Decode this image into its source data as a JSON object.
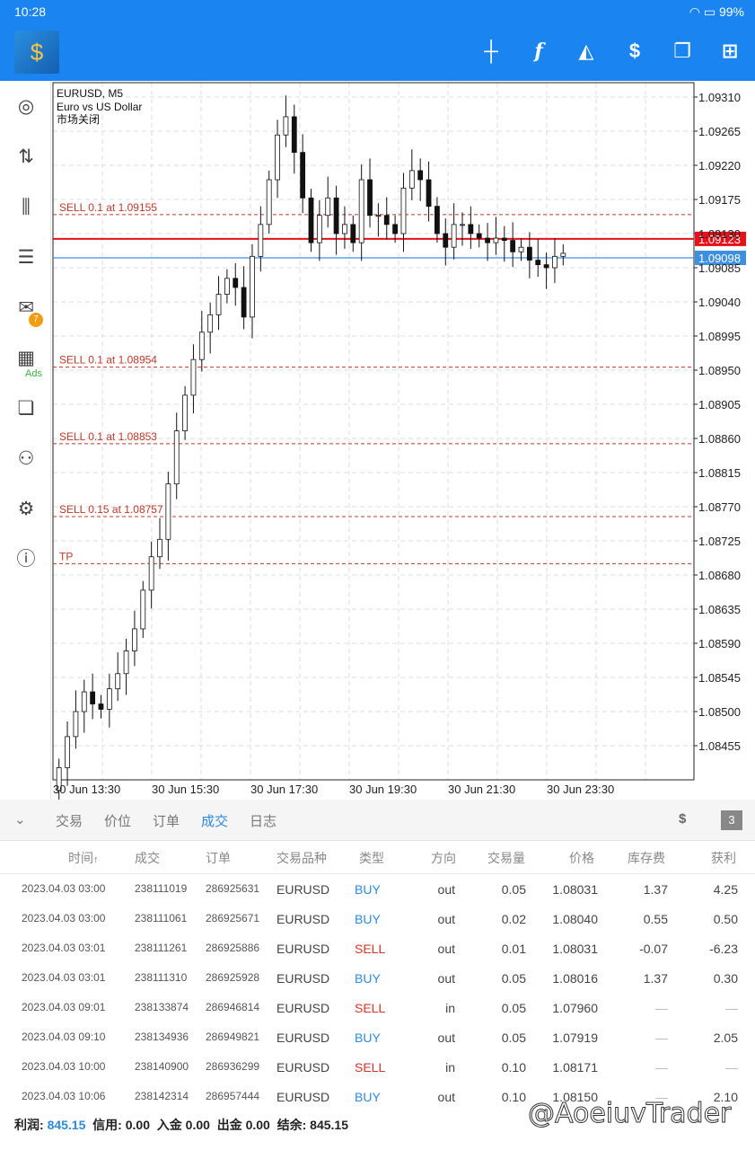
{
  "status_bar": {
    "time": "10:28",
    "battery": "99%"
  },
  "toolbar": {
    "icons": [
      "crosshair-icon",
      "function-icon",
      "objects-icon",
      "trade-icon",
      "windows-icon",
      "new-order-icon"
    ]
  },
  "sidebar": {
    "mail_badge": "7",
    "ads_label": "Ads"
  },
  "chart": {
    "symbol": "EURUSD, M5",
    "description": "Euro vs US Dollar",
    "status": "市场关闭",
    "price_ticks": [
      "1.09310",
      "1.09265",
      "1.09220",
      "1.09175",
      "1.09130",
      "1.09085",
      "1.09040",
      "1.08995",
      "1.08950",
      "1.08905",
      "1.08860",
      "1.08815",
      "1.08770",
      "1.08725",
      "1.08680",
      "1.08635",
      "1.08590",
      "1.08545",
      "1.08500",
      "1.08455"
    ],
    "time_ticks": [
      "30 Jun 13:30",
      "30 Jun 15:30",
      "30 Jun 17:30",
      "30 Jun 19:30",
      "30 Jun 21:30",
      "30 Jun 23:30"
    ],
    "bid": {
      "label": "1.09123",
      "price": 1.09123,
      "color": "#e8101a"
    },
    "ask": {
      "label": "1.09098",
      "price": 1.09098,
      "color": "#3d8fe0"
    },
    "order_lines": [
      {
        "label": "SELL 0.1 at 1.09155",
        "price": 1.09155
      },
      {
        "label": "SELL 0.1 at 1.08954",
        "price": 1.08954
      },
      {
        "label": "SELL 0.1 at 1.08853",
        "price": 1.08853
      },
      {
        "label": "SELL 0.15 at 1.08757",
        "price": 1.08757
      },
      {
        "label": "TP",
        "price": 1.08695
      }
    ],
    "closes": [
      1.08426,
      1.08467,
      1.085,
      1.08526,
      1.0851,
      1.08503,
      1.0853,
      1.0855,
      1.0858,
      1.08609,
      1.0866,
      1.08704,
      1.08727,
      1.088,
      1.0887,
      1.08917,
      1.08964,
      1.09,
      1.09023,
      1.0905,
      1.09071,
      1.09059,
      1.0902,
      1.091,
      1.09142,
      1.09201,
      1.0926,
      1.09284,
      1.09237,
      1.09177,
      1.09118,
      1.09154,
      1.09177,
      1.0913,
      1.09142,
      1.09118,
      1.09201,
      1.09154,
      1.09154,
      1.09142,
      1.0913,
      1.0919,
      1.09213,
      1.09201,
      1.09166,
      1.0913,
      1.09112,
      1.09142,
      1.09142,
      1.0913,
      1.09124,
      1.09118,
      1.09124,
      1.09121,
      1.09106,
      1.09112,
      1.09095,
      1.09089,
      1.09085,
      1.091,
      1.09104
    ]
  },
  "tabs": [
    {
      "label": "交易"
    },
    {
      "label": "价位"
    },
    {
      "label": "订单"
    },
    {
      "label": "成交",
      "active": true
    },
    {
      "label": "日志"
    }
  ],
  "tabs_badge": "3",
  "table": {
    "headers": [
      "时间",
      "成交",
      "订单",
      "交易品种",
      "类型",
      "方向",
      "交易量",
      "价格",
      "库存费",
      "获利"
    ],
    "sort_indicator": "↑",
    "rows": [
      [
        "2023.04.03 03:00",
        "238111019",
        "286925631",
        "EURUSD",
        "BUY",
        "out",
        "0.05",
        "1.08031",
        "1.37",
        "4.25"
      ],
      [
        "2023.04.03 03:00",
        "238111061",
        "286925671",
        "EURUSD",
        "BUY",
        "out",
        "0.02",
        "1.08040",
        "0.55",
        "0.50"
      ],
      [
        "2023.04.03 03:01",
        "238111261",
        "286925886",
        "EURUSD",
        "SELL",
        "out",
        "0.01",
        "1.08031",
        "-0.07",
        "-6.23"
      ],
      [
        "2023.04.03 03:01",
        "238111310",
        "286925928",
        "EURUSD",
        "BUY",
        "out",
        "0.05",
        "1.08016",
        "1.37",
        "0.30"
      ],
      [
        "2023.04.03 09:01",
        "238133874",
        "286946814",
        "EURUSD",
        "SELL",
        "in",
        "0.05",
        "1.07960",
        "—",
        "—"
      ],
      [
        "2023.04.03 09:10",
        "238134936",
        "286949821",
        "EURUSD",
        "BUY",
        "out",
        "0.05",
        "1.07919",
        "—",
        "2.05"
      ],
      [
        "2023.04.03 10:00",
        "238140900",
        "286936299",
        "EURUSD",
        "SELL",
        "in",
        "0.10",
        "1.08171",
        "—",
        "—"
      ],
      [
        "2023.04.03 10:06",
        "238142314",
        "286957444",
        "EURUSD",
        "BUY",
        "out",
        "0.10",
        "1.08150",
        "—",
        "2.10"
      ]
    ]
  },
  "footer": {
    "profit_label": "利润:",
    "profit": "845.15",
    "credit_label": "信用:",
    "credit": "0.00",
    "deposit_label": "入金",
    "deposit": "0.00",
    "withdraw_label": "出金",
    "withdraw": "0.00",
    "balance_label": "结余:",
    "balance": "845.15"
  },
  "watermark": "@AoeiuvTrader"
}
